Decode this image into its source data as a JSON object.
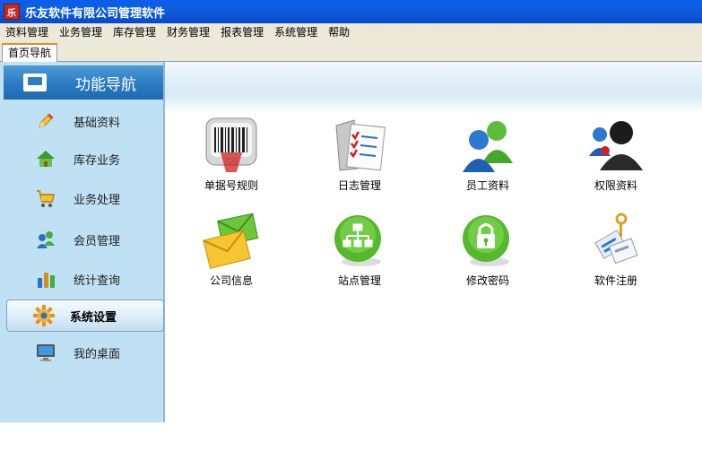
{
  "window": {
    "title": "乐友软件有限公司管理软件",
    "app_icon_text": "乐"
  },
  "menu": [
    "资料管理",
    "业务管理",
    "库存管理",
    "财务管理",
    "报表管理",
    "系统管理",
    "帮助"
  ],
  "tabs": [
    {
      "label": "首页导航"
    }
  ],
  "sidebar": {
    "header": "功能导航",
    "items": [
      {
        "label": "基础资料",
        "icon": "pencil-icon"
      },
      {
        "label": "库存业务",
        "icon": "house-icon"
      },
      {
        "label": "业务处理",
        "icon": "cart-icon"
      },
      {
        "label": "会员管理",
        "icon": "members-icon"
      },
      {
        "label": "统计查询",
        "icon": "bar-chart-icon"
      },
      {
        "label": "系统设置",
        "icon": "gear-icon",
        "selected": true
      },
      {
        "label": "我的桌面",
        "icon": "monitor-icon"
      }
    ]
  },
  "tiles": [
    {
      "label": "单据号规则",
      "icon": "barcode-scanner-icon"
    },
    {
      "label": "日志管理",
      "icon": "checklist-folder-icon"
    },
    {
      "label": "员工资料",
      "icon": "users-icon"
    },
    {
      "label": "权限资料",
      "icon": "user-admin-icon"
    },
    {
      "label": "公司信息",
      "icon": "envelopes-icon"
    },
    {
      "label": "站点管理",
      "icon": "sitemap-icon"
    },
    {
      "label": "修改密码",
      "icon": "padlock-icon"
    },
    {
      "label": "软件注册",
      "icon": "tags-key-icon"
    }
  ],
  "colors": {
    "titlebar": "#0a5ee8",
    "sidebar_bg": "#bfe1f3",
    "header_bg": "#2c7dc4",
    "tab_accent": "#e68b2c"
  }
}
